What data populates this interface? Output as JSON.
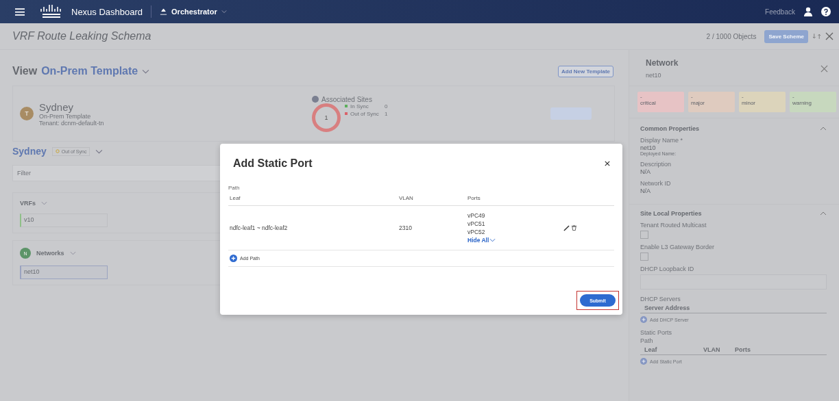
{
  "header": {
    "app_name": "Nexus Dashboard",
    "context": "Orchestrator",
    "feedback": "Feedback"
  },
  "schema": {
    "title": "VRF Route Leaking Schema",
    "objects": "2 / 1000 Objects",
    "save": "Save Scheme"
  },
  "view": {
    "label": "View",
    "template": "On-Prem Template",
    "add_button": "Add New Template"
  },
  "site_card": {
    "avatar": "T",
    "name": "Sydney",
    "type": "On-Prem Template",
    "tenant": "Tenant: dcnm-default-tn",
    "sites_title": "Associated Sites",
    "sites_total": "1",
    "legend": [
      {
        "label": "In Sync",
        "count": "0",
        "color": "#5cae5c"
      },
      {
        "label": "Out of Sync",
        "count": "1",
        "color": "#d9626a"
      }
    ]
  },
  "site_section": {
    "name": "Sydney",
    "status": "Out of Sync",
    "filter_placeholder": "Filter"
  },
  "groups": [
    {
      "title": "VRFs",
      "items": [
        "v10"
      ]
    },
    {
      "title": "Networks",
      "avatar": "N",
      "items": [
        "net10"
      ]
    }
  ],
  "panel": {
    "title": "Network",
    "subtitle": "net10",
    "severities": [
      {
        "value": "-",
        "label": "critical",
        "color": "#e7c3c5"
      },
      {
        "value": "-",
        "label": "major",
        "color": "#dfcbbf"
      },
      {
        "value": "-",
        "label": "minor",
        "color": "#dcd4bb"
      },
      {
        "value": "-",
        "label": "warning",
        "color": "#c7d8be"
      }
    ],
    "common": {
      "title": "Common Properties",
      "fields": [
        {
          "label": "Display Name *",
          "value": "net10",
          "note": "Deployed Name:"
        },
        {
          "label": "Description",
          "value": "N/A"
        },
        {
          "label": "Network ID",
          "value": "N/A"
        }
      ]
    },
    "site_local": {
      "title": "Site Local Properties",
      "checkboxes": [
        {
          "label": "Tenant Routed Multicast",
          "checked": false
        },
        {
          "label": "Enable L3 Gateway Border",
          "checked": false
        }
      ],
      "loopback_label": "DHCP Loopback ID",
      "dhcp_label": "DHCP Servers",
      "dhcp_column": "Server Address",
      "dhcp_add": "Add DHCP Server",
      "ports_label": "Static Ports",
      "ports_path": "Path",
      "ports_columns": [
        "Leaf",
        "VLAN",
        "Ports"
      ],
      "ports_add": "Add Static Port"
    }
  },
  "modal": {
    "title": "Add Static Port",
    "path_label": "Path",
    "columns": [
      "Leaf",
      "VLAN",
      "Ports"
    ],
    "rows": [
      {
        "leaf": "ndfc-leaf1 ~ ndfc-leaf2",
        "vlan": "2310",
        "ports": [
          "vPC49",
          "vPC51",
          "vPC52"
        ],
        "toggle": "Hide All"
      }
    ],
    "add_path": "Add Path",
    "submit": "Submit",
    "submit_highlighted": true
  }
}
